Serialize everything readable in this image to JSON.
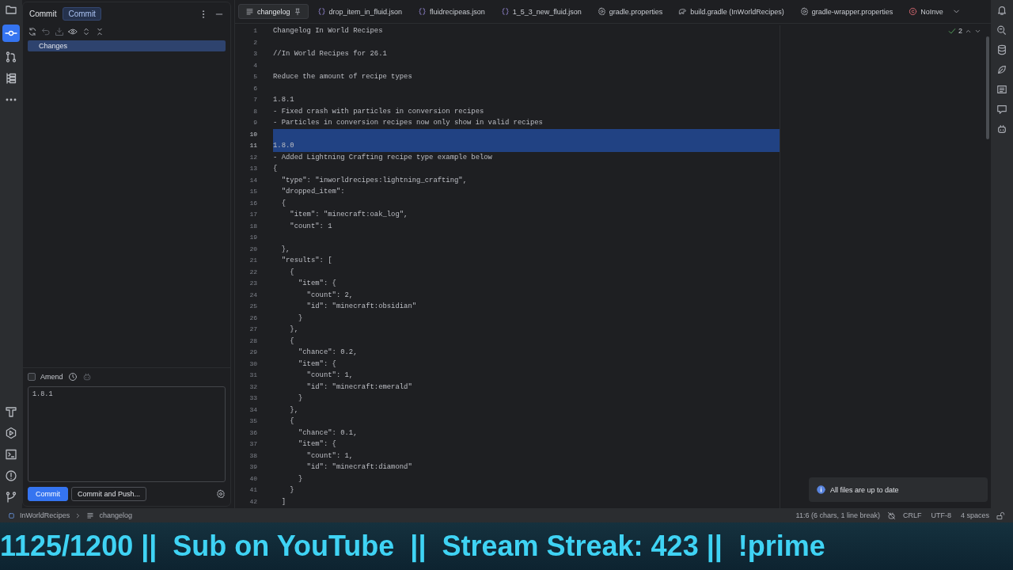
{
  "left_toolbar": {
    "top": [
      {
        "kind": "folder",
        "selected": false
      },
      {
        "kind": "commit",
        "selected": true
      },
      {
        "kind": "pull",
        "selected": false
      },
      {
        "kind": "structure",
        "selected": false
      },
      {
        "kind": "more",
        "selected": false
      }
    ],
    "bottom": [
      {
        "kind": "hammer",
        "selected": false
      },
      {
        "kind": "run",
        "selected": false
      },
      {
        "kind": "terminal",
        "selected": false
      },
      {
        "kind": "problems",
        "selected": false
      },
      {
        "kind": "git",
        "selected": false
      }
    ]
  },
  "commit_panel": {
    "title": "Commit",
    "tabs": [
      {
        "label": "Commit",
        "selected": true
      }
    ],
    "tree": [
      {
        "label": "Changes",
        "selected": true
      }
    ],
    "amend": {
      "label": "Amend",
      "checked": false
    },
    "message": {
      "value": "1.8.1"
    },
    "buttons": [
      {
        "label": "Commit",
        "kind": "primary"
      },
      {
        "label": "Commit and Push...",
        "kind": "secondary"
      }
    ]
  },
  "editor": {
    "tabs": [
      {
        "label": "changelog",
        "kind": "text",
        "selected": true,
        "pinned": true
      },
      {
        "label": "drop_item_in_fluid.json",
        "kind": "json",
        "selected": false,
        "pinned": false
      },
      {
        "label": "fluidrecipeas.json",
        "kind": "json",
        "selected": false,
        "pinned": false
      },
      {
        "label": "1_5_3_new_fluid.json",
        "kind": "json",
        "selected": false,
        "pinned": false
      },
      {
        "label": "gradle.properties",
        "kind": "gear",
        "selected": false,
        "pinned": false
      },
      {
        "label": "build.gradle (InWorldRecipes)",
        "kind": "gradle",
        "selected": false,
        "pinned": false
      },
      {
        "label": "gradle-wrapper.properties",
        "kind": "gear",
        "selected": false,
        "pinned": false
      },
      {
        "label": "NoInve",
        "kind": "class",
        "selected": false,
        "pinned": false
      }
    ],
    "inspections": "2",
    "lines": [
      {
        "number": "1",
        "text": "Changelog In World Recipes",
        "selected": false
      },
      {
        "number": "2",
        "selected": false
      },
      {
        "number": "3",
        "text": "//In World Recipes for 26.1",
        "selected": false
      },
      {
        "number": "4",
        "selected": false
      },
      {
        "number": "5",
        "text": "Reduce the amount of recipe types",
        "selected": false
      },
      {
        "number": "6",
        "selected": false
      },
      {
        "number": "7",
        "text": "1.8.1",
        "selected": false
      },
      {
        "number": "8",
        "text": "- Fixed crash with particles in conversion recipes",
        "selected": false
      },
      {
        "number": "9",
        "text": "- Particles in conversion recipes now only show in valid recipes",
        "selected": false
      },
      {
        "number": "10",
        "selected": true
      },
      {
        "number": "11",
        "text": "1.8.0",
        "selected": true
      },
      {
        "number": "12",
        "text": "- Added Lightning Crafting recipe type example below",
        "selected": false
      },
      {
        "number": "13",
        "text": "{",
        "selected": false
      },
      {
        "number": "14",
        "text": "  \"type\": \"inworldrecipes:lightning_crafting\",",
        "selected": false
      },
      {
        "number": "15",
        "text": "  \"dropped_item\":",
        "selected": false
      },
      {
        "number": "16",
        "text": "  {",
        "selected": false
      },
      {
        "number": "17",
        "text": "    \"item\": \"minecraft:oak_log\",",
        "selected": false
      },
      {
        "number": "18",
        "text": "    \"count\": 1",
        "selected": false
      },
      {
        "number": "19",
        "selected": false
      },
      {
        "number": "20",
        "text": "  },",
        "selected": false
      },
      {
        "number": "21",
        "text": "  \"results\": [",
        "selected": false
      },
      {
        "number": "22",
        "text": "    {",
        "selected": false
      },
      {
        "number": "23",
        "text": "      \"item\": {",
        "selected": false
      },
      {
        "number": "24",
        "text": "        \"count\": 2,",
        "selected": false
      },
      {
        "number": "25",
        "text": "        \"id\": \"minecraft:obsidian\"",
        "selected": false
      },
      {
        "number": "26",
        "text": "      }",
        "selected": false
      },
      {
        "number": "27",
        "text": "    },",
        "selected": false
      },
      {
        "number": "28",
        "text": "    {",
        "selected": false
      },
      {
        "number": "29",
        "text": "      \"chance\": 0.2,",
        "selected": false
      },
      {
        "number": "30",
        "text": "      \"item\": {",
        "selected": false
      },
      {
        "number": "31",
        "text": "        \"count\": 1,",
        "selected": false
      },
      {
        "number": "32",
        "text": "        \"id\": \"minecraft:emerald\"",
        "selected": false
      },
      {
        "number": "33",
        "text": "      }",
        "selected": false
      },
      {
        "number": "34",
        "text": "    },",
        "selected": false
      },
      {
        "number": "35",
        "text": "    {",
        "selected": false
      },
      {
        "number": "36",
        "text": "      \"chance\": 0.1,",
        "selected": false
      },
      {
        "number": "37",
        "text": "      \"item\": {",
        "selected": false
      },
      {
        "number": "38",
        "text": "        \"count\": 1,",
        "selected": false
      },
      {
        "number": "39",
        "text": "        \"id\": \"minecraft:diamond\"",
        "selected": false
      },
      {
        "number": "40",
        "text": "      }",
        "selected": false
      },
      {
        "number": "41",
        "text": "    }",
        "selected": false
      },
      {
        "number": "42",
        "text": "  ]",
        "selected": false
      }
    ]
  },
  "notification": {
    "text": "All files are up to date"
  },
  "status_bar": {
    "breadcrumbs": [
      "InWorldRecipes",
      "changelog"
    ],
    "position": "11:6 (6 chars, 1 line break)",
    "line_separator": "CRLF",
    "encoding": "UTF-8",
    "indent": "4 spaces"
  },
  "ticker": {
    "text": "1125/1200 ||  Sub on YouTube  ||  Stream Streak: 423 ||  !prime"
  }
}
